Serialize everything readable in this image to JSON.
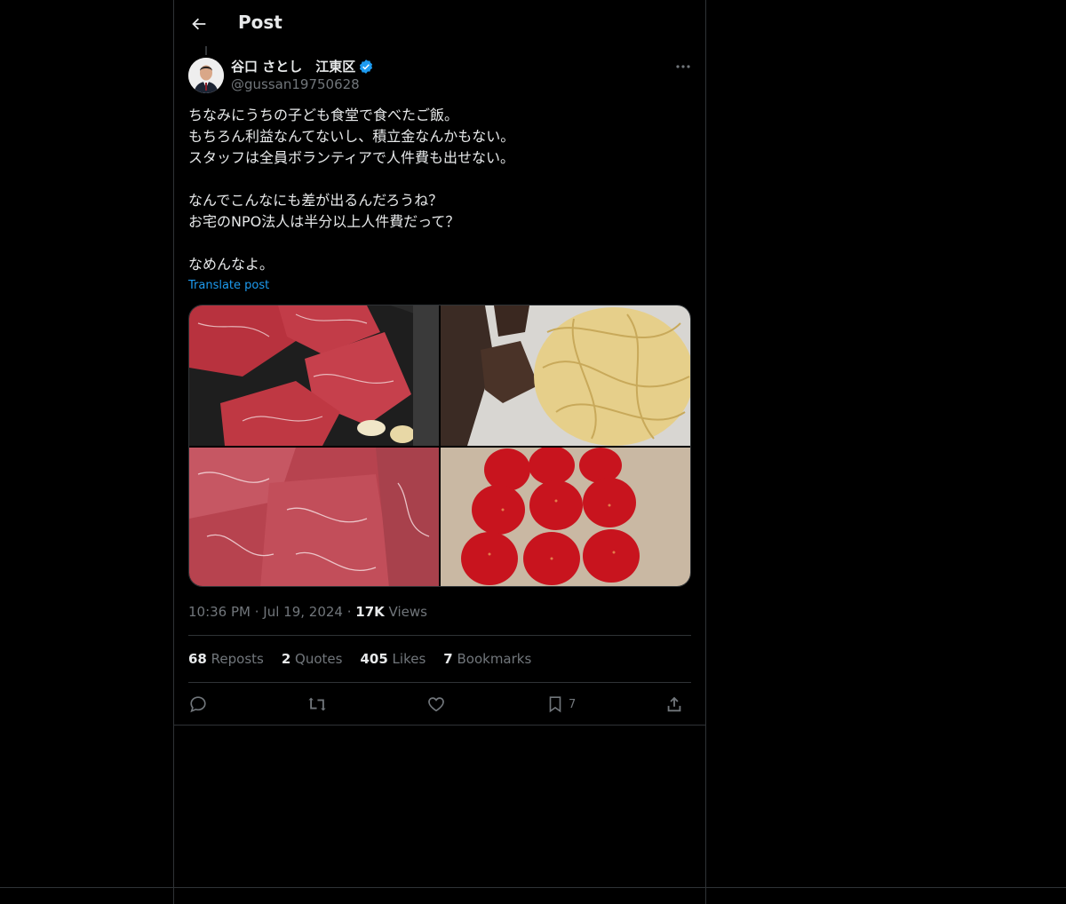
{
  "header": {
    "title": "Post",
    "back_icon": "arrow-left-icon"
  },
  "author": {
    "display_name": "谷口 さとし　江東区",
    "handle": "@gussan19750628",
    "verified_icon": "verified-badge-icon",
    "verified_color": "#1d9bf0"
  },
  "post": {
    "lines": [
      "ちなみにうちの子ども食堂で食べたご飯。",
      "もちろん利益なんてないし、積立金なんかもない。",
      "スタッフは全員ボランティアで人件費も出せない。",
      "",
      "なんでこんなにも差が出るんだろうね？",
      "お宅のNPO法人は半分以上人件費だって？",
      "",
      "なめんなよ。"
    ],
    "translate_label": "Translate post"
  },
  "media": [
    {
      "name": "raw-wagyu-in-pan",
      "icon": "photo"
    },
    {
      "name": "steak-and-pasta",
      "icon": "photo"
    },
    {
      "name": "raw-wagyu-closeup",
      "icon": "photo"
    },
    {
      "name": "strawberries",
      "icon": "photo"
    }
  ],
  "meta": {
    "time": "10:36 PM",
    "dot1": " · ",
    "date": "Jul 19, 2024",
    "dot2": " · ",
    "views_count": "17K",
    "views_label": " Views"
  },
  "stats": [
    {
      "count": "68",
      "label": " Reposts"
    },
    {
      "count": "2",
      "label": " Quotes"
    },
    {
      "count": "405",
      "label": " Likes"
    },
    {
      "count": "7",
      "label": " Bookmarks"
    }
  ],
  "actions": {
    "reply_icon": "reply-icon",
    "repost_icon": "repost-icon",
    "like_icon": "heart-icon",
    "bookmark_icon": "bookmark-icon",
    "bookmark_count": "7",
    "share_icon": "share-icon"
  },
  "colors": {
    "background": "#000000",
    "text": "#e7e9ea",
    "muted": "#71767b",
    "link": "#1d9bf0",
    "border": "#2f3336"
  }
}
